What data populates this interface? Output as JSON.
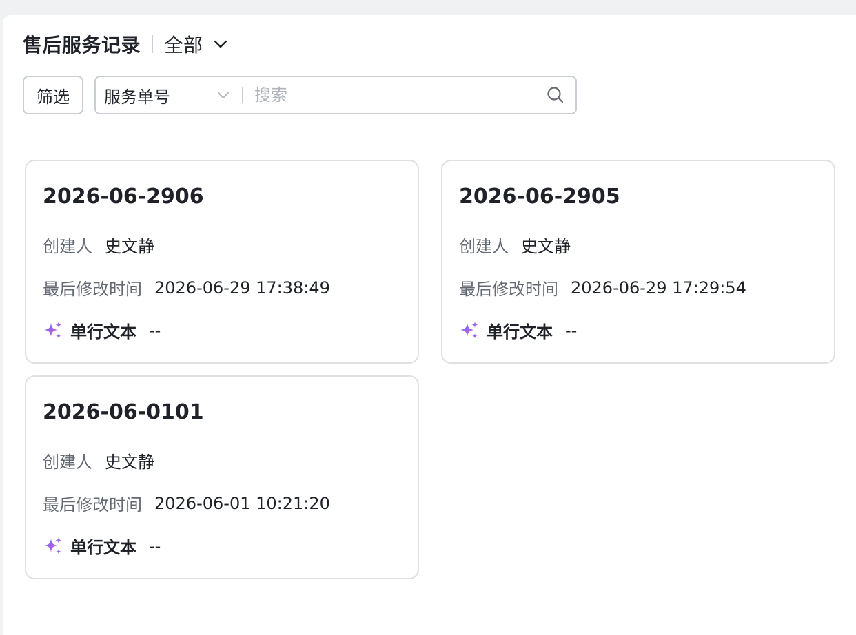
{
  "header": {
    "title": "售后服务记录",
    "scope": "全部"
  },
  "toolbar": {
    "filter_label": "筛选",
    "search_field": "服务单号",
    "search_placeholder": "搜索"
  },
  "labels": {
    "creator": "创建人",
    "modified": "最后修改时间",
    "single_line_text": "单行文本"
  },
  "records": [
    {
      "id": "2026-06-2906",
      "creator": "史文静",
      "modified": "2026-06-29 17:38:49",
      "single_line_text": "--"
    },
    {
      "id": "2026-06-2905",
      "creator": "史文静",
      "modified": "2026-06-29 17:29:54",
      "single_line_text": "--"
    },
    {
      "id": "2026-06-0101",
      "creator": "史文静",
      "modified": "2026-06-01 10:21:20",
      "single_line_text": "--"
    }
  ],
  "colors": {
    "spark_start": "#5b6cff",
    "spark_end": "#e45bd6",
    "border": "#dee0e3"
  },
  "icons": {
    "scope_dropdown": "chevron-down-icon",
    "field_dropdown": "chevron-down-icon",
    "search": "search-icon",
    "ai_field": "sparkle-icon"
  }
}
